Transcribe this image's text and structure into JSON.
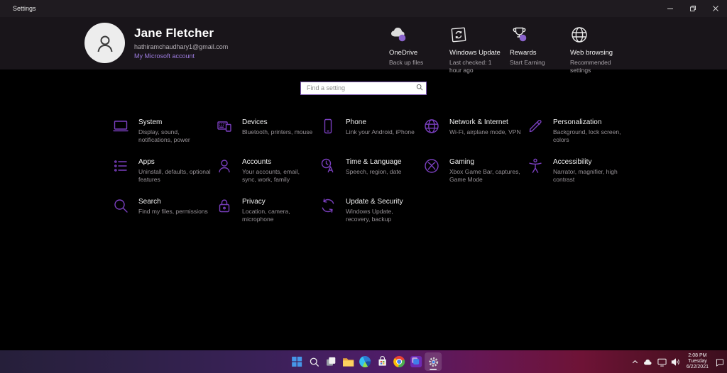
{
  "window": {
    "title": "Settings"
  },
  "header": {
    "profile": {
      "name": "Jane Fletcher",
      "email": "hathiramchaudhary1@gmail.com",
      "link": "My Microsoft account"
    },
    "quick_actions": [
      {
        "icon": "onedrive",
        "title": "OneDrive",
        "subtitle": "Back up files"
      },
      {
        "icon": "windows-update",
        "title": "Windows Update",
        "subtitle": "Last checked: 1 hour ago"
      },
      {
        "icon": "rewards",
        "title": "Rewards",
        "subtitle": "Start Earning"
      },
      {
        "icon": "web-browsing",
        "title": "Web browsing",
        "subtitle": "Recommended settings"
      }
    ]
  },
  "search": {
    "placeholder": "Find a setting",
    "icon": "search-icon"
  },
  "categories": [
    {
      "icon": "system",
      "title": "System",
      "subtitle": "Display, sound, notifications, power"
    },
    {
      "icon": "devices",
      "title": "Devices",
      "subtitle": "Bluetooth, printers, mouse"
    },
    {
      "icon": "phone",
      "title": "Phone",
      "subtitle": "Link your Android, iPhone"
    },
    {
      "icon": "network",
      "title": "Network & Internet",
      "subtitle": "Wi-Fi, airplane mode, VPN"
    },
    {
      "icon": "personalization",
      "title": "Personalization",
      "subtitle": "Background, lock screen, colors"
    },
    {
      "icon": "apps",
      "title": "Apps",
      "subtitle": "Uninstall, defaults, optional features"
    },
    {
      "icon": "accounts",
      "title": "Accounts",
      "subtitle": "Your accounts, email, sync, work, family"
    },
    {
      "icon": "time-language",
      "title": "Time & Language",
      "subtitle": "Speech, region, date"
    },
    {
      "icon": "gaming",
      "title": "Gaming",
      "subtitle": "Xbox Game Bar, captures, Game Mode"
    },
    {
      "icon": "accessibility",
      "title": "Accessibility",
      "subtitle": "Narrator, magnifier, high contrast"
    },
    {
      "icon": "search",
      "title": "Search",
      "subtitle": "Find my files, permissions"
    },
    {
      "icon": "privacy",
      "title": "Privacy",
      "subtitle": "Location, camera, microphone"
    },
    {
      "icon": "update-security",
      "title": "Update & Security",
      "subtitle": "Windows Update, recovery, backup"
    }
  ],
  "taskbar": {
    "pinned": [
      {
        "icon": "start"
      },
      {
        "icon": "taskbar-search"
      },
      {
        "icon": "task-view"
      },
      {
        "icon": "file-explorer"
      },
      {
        "icon": "edge"
      },
      {
        "icon": "store"
      },
      {
        "icon": "chrome"
      },
      {
        "icon": "pinned-app"
      },
      {
        "icon": "settings-gear",
        "active": true
      }
    ],
    "tray_icons": [
      {
        "icon": "chevron-up"
      },
      {
        "icon": "tray-cloud"
      },
      {
        "icon": "tray-display"
      },
      {
        "icon": "tray-volume"
      }
    ],
    "clock": {
      "time": "2:08 PM",
      "day": "Tuesday",
      "date": "6/22/2021"
    },
    "notification_icon": "notification-bubble"
  },
  "colors": {
    "accent_link": "#9d7ce0",
    "category_icon": "#7a3fbf",
    "quick_action_dot": "#8a63cc",
    "search_border": "#7e58b4"
  }
}
